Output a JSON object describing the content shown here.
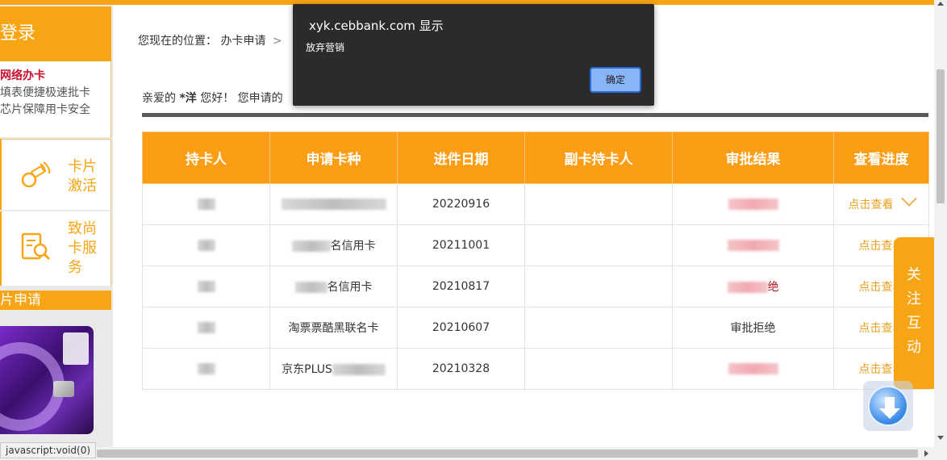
{
  "sidebar": {
    "login_label": "登录",
    "promo_title": "网络办卡",
    "promo_line1": "填表便捷极速批卡",
    "promo_line2": "芯片保障用卡安全",
    "activate_label": "卡片激活",
    "service_label": "致尚卡服务",
    "apply_label": "片申请"
  },
  "breadcrumb": {
    "prefix": "您现在的位置：",
    "current": "办卡申请",
    "separator": ">"
  },
  "greeting": {
    "text_before": "亲爱的",
    "name": "*洋",
    "text_after": "您好！ 您申请的"
  },
  "table": {
    "headers": [
      "持卡人",
      "申请卡种",
      "进件日期",
      "副卡持卡人",
      "审批结果",
      "查看进度"
    ],
    "rows": [
      {
        "card_type": "",
        "date": "20220916",
        "result": "",
        "action": "点击查看"
      },
      {
        "card_type": "名信用卡",
        "date": "20211001",
        "result": "",
        "action": "点击查看"
      },
      {
        "card_type": "名信用卡",
        "date": "20210817",
        "result": "绝",
        "action": "点击查看"
      },
      {
        "card_type": "淘票票酷黑联名卡",
        "date": "20210607",
        "result": "审批拒绝",
        "action": "点击查看"
      },
      {
        "card_type": "京东PLUS",
        "date": "20210328",
        "result": "",
        "action": "点击查看"
      }
    ]
  },
  "float": {
    "follow_label": "关注互动"
  },
  "status": {
    "text": "javascript:void(0)"
  },
  "dialog": {
    "title": "xyk.cebbank.com 显示",
    "message": "放弃营销",
    "ok_label": "确定"
  },
  "colors": {
    "accent": "#f8a515",
    "reject": "#b0101e",
    "link": "#e8a020"
  }
}
